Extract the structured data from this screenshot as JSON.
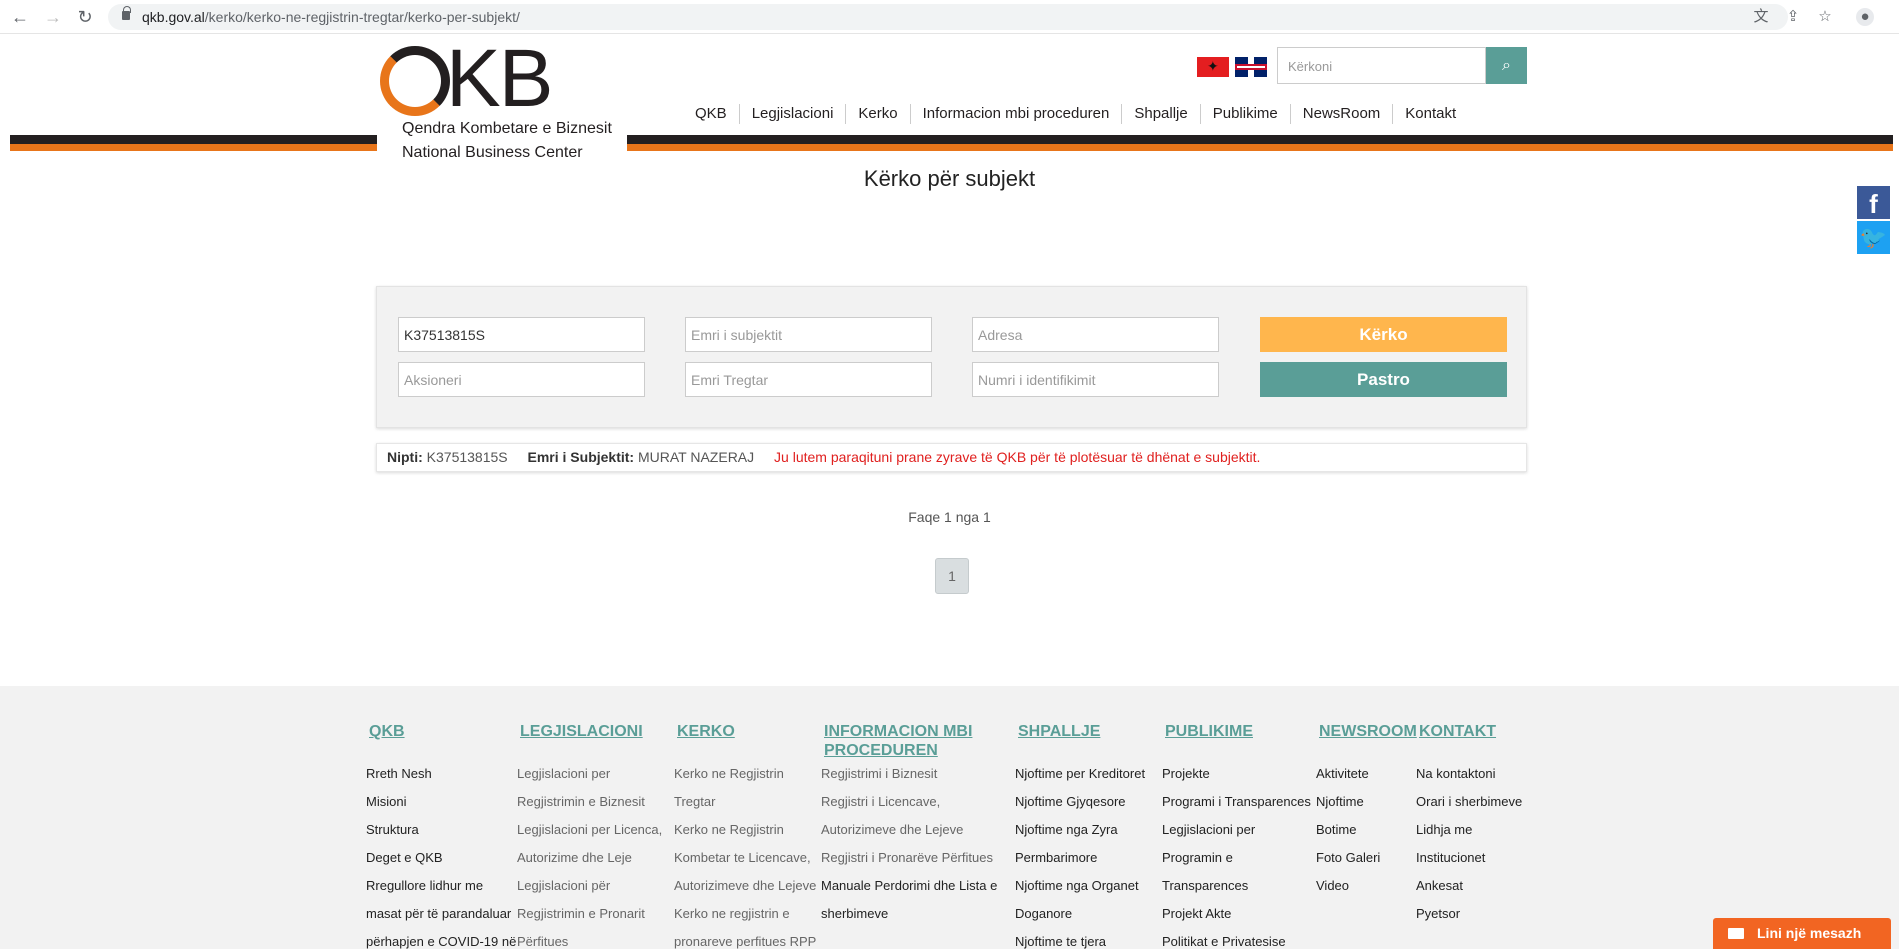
{
  "browser": {
    "url_domain": "qkb.gov.al",
    "url_path": "/kerko/kerko-ne-regjistrin-tregtar/kerko-per-subjekt/"
  },
  "header": {
    "logo_text": "QKB",
    "logo_line1": "Qendra Kombetare e Biznesit",
    "logo_line2": "National Business Center",
    "search_placeholder": "Kërkoni",
    "nav": [
      "QKB",
      "Legjislacioni",
      "Kerko",
      "Informacion mbi proceduren",
      "Shpallje",
      "Publikime",
      "NewsRoom",
      "Kontakt"
    ]
  },
  "page": {
    "title": "Kërko për subjekt"
  },
  "form": {
    "nipt_value": "K37513815S",
    "name_placeholder": "Emri i subjektit",
    "address_placeholder": "Adresa",
    "shareholder_placeholder": "Aksioneri",
    "trade_name_placeholder": "Emri Tregtar",
    "id_placeholder": "Numri i identifikimit",
    "search_label": "Kërko",
    "clear_label": "Pastro"
  },
  "result": {
    "nipt_label": "Nipti:",
    "nipt": "K37513815S",
    "name_label": "Emri i Subjektit:",
    "name": "MURAT NAZERAJ",
    "warning": "Ju lutem paraqituni prane zyrave të QKB për të plotësuar të dhënat e subjektit."
  },
  "pager": {
    "text": "Faqe 1 nga 1",
    "current": "1"
  },
  "footer": {
    "columns": [
      {
        "title": "QKB",
        "links": [
          "Rreth Nesh",
          "Misioni",
          "Struktura",
          "Deget e QKB",
          "Rregullore lidhur me",
          "masat për të parandaluar",
          "përhapjen e COVID-19 në"
        ]
      },
      {
        "title": "LEGJISLACIONI",
        "links": [
          "Legjislacioni per",
          "Regjistrimin e Biznesit",
          "Legjislacioni per Licenca,",
          "Autorizime dhe Leje",
          "Legjislacioni për",
          "Regjistrimin e Pronarit",
          "Përfitues"
        ]
      },
      {
        "title": "KERKO",
        "links": [
          "Kerko ne Regjistrin",
          "Tregtar",
          "Kerko ne Regjistrin",
          "Kombetar te Licencave,",
          "Autorizimeve dhe Lejeve",
          "Kerko ne regjistrin e",
          "pronareve perfitues RPP"
        ]
      },
      {
        "title_line1": "INFORMACION MBI",
        "title_line2": "PROCEDUREN",
        "links": [
          "Regjistrimi i Biznesit",
          "Regjistri i Licencave,",
          "Autorizimeve dhe Lejeve",
          "Regjistri i Pronarëve Përfitues",
          "Manuale Perdorimi dhe Lista e",
          "sherbimeve"
        ]
      },
      {
        "title": "SHPALLJE",
        "links": [
          "Njoftime per Kreditoret",
          "Njoftime Gjyqesore",
          "Njoftime nga Zyra",
          "Permbarimore",
          "Njoftime nga Organet",
          "Doganore",
          "Njoftime te tjera"
        ]
      },
      {
        "title": "PUBLIKIME",
        "links": [
          "Projekte",
          "Programi i Transparences",
          "Legjislacioni per",
          "Programin e",
          "Transparences",
          "Projekt Akte",
          "Politikat e Privatesise"
        ]
      },
      {
        "title": "NEWSROOM",
        "links": [
          "Aktivitete",
          "Njoftime",
          "Botime",
          "Foto Galeri",
          "Video"
        ]
      },
      {
        "title": "KONTAKT",
        "links": [
          "Na kontaktoni",
          "Orari i sherbimeve",
          "Lidhja me",
          "Institucionet",
          "Ankesat",
          "Pyetsor"
        ]
      }
    ]
  },
  "chat": {
    "label": "Lini një mesazh"
  },
  "colors": {
    "teal": "#5a9e97",
    "orange": "#e8751a",
    "search_button": "#ffb64d",
    "warning": "#e0201f"
  }
}
